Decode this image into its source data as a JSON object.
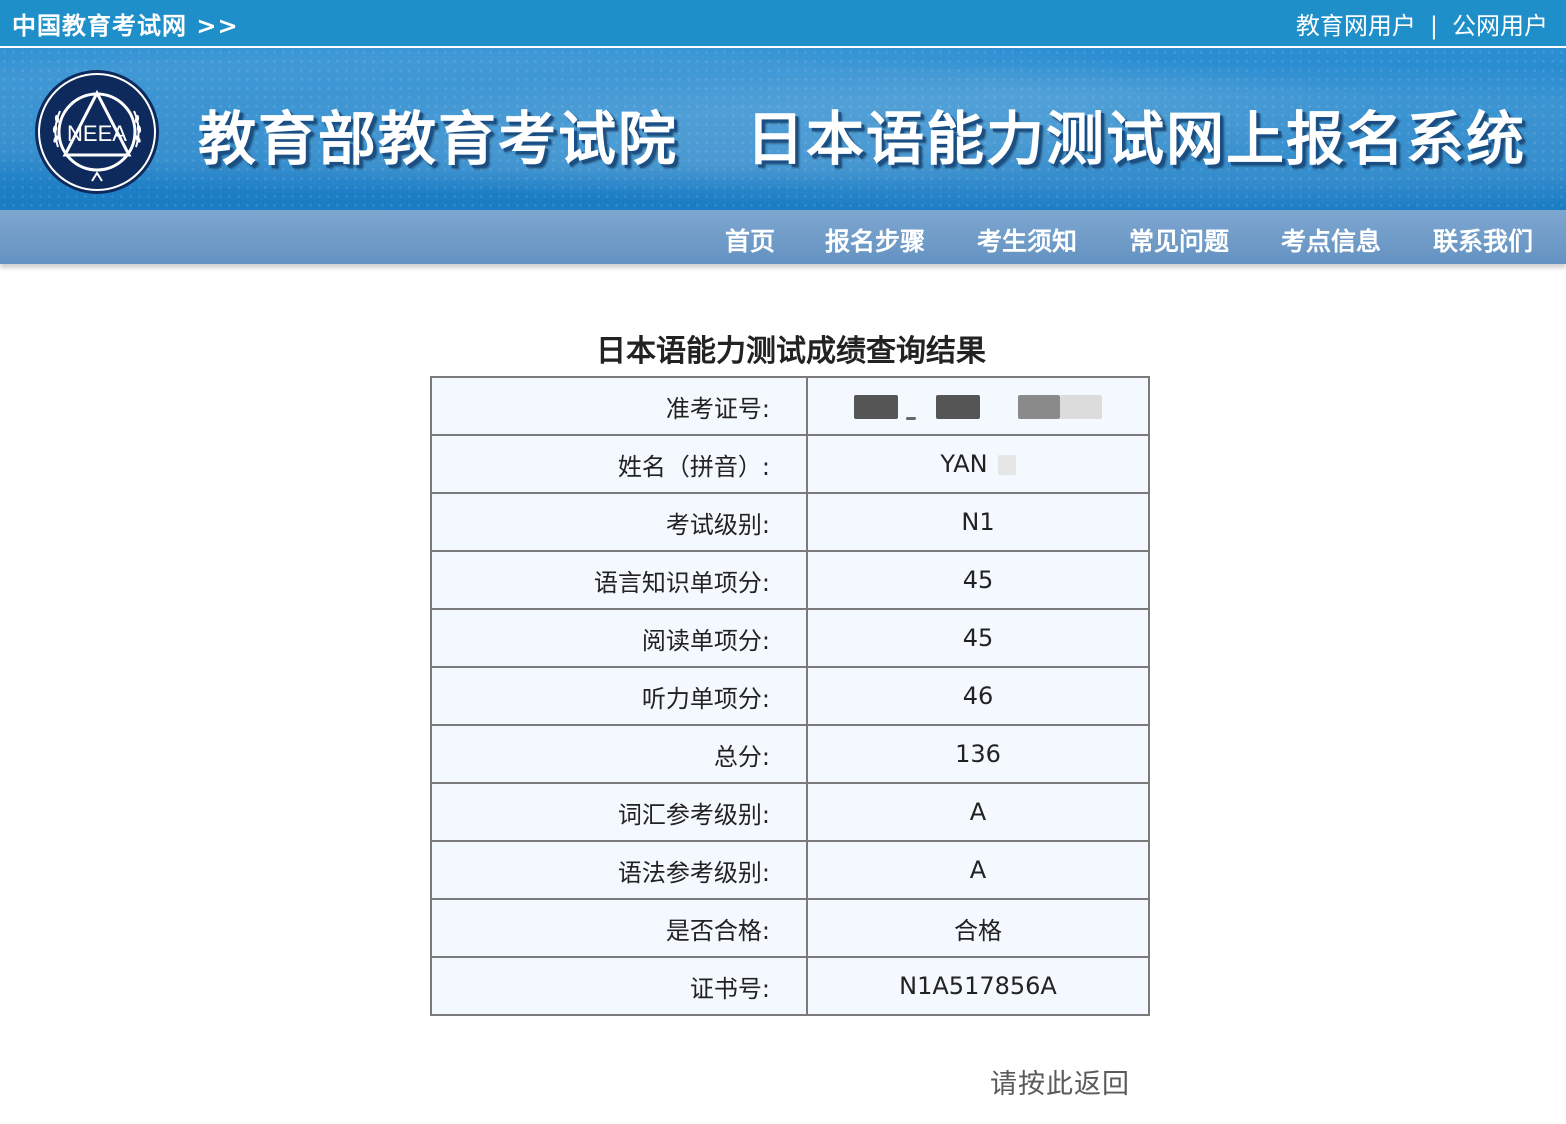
{
  "topbar": {
    "site_link": "中国教育考试网 >>",
    "user_links": [
      "教育网用户",
      "公网用户"
    ],
    "separator": "|"
  },
  "banner": {
    "logo_text": "NEEA",
    "title_left": "教育部教育考试院",
    "title_right": "日本语能力测试网上报名系统"
  },
  "nav": {
    "items": [
      "首页",
      "报名步骤",
      "考生须知",
      "常见问题",
      "考点信息",
      "联系我们"
    ]
  },
  "result": {
    "title": "日本语能力测试成绩查询结果",
    "rows": [
      {
        "label": "准考证号:",
        "value": ""
      },
      {
        "label": "姓名（拼音）:",
        "value": "YAN"
      },
      {
        "label": "考试级别:",
        "value": "N1"
      },
      {
        "label": "语言知识单项分:",
        "value": "45"
      },
      {
        "label": "阅读单项分:",
        "value": "45"
      },
      {
        "label": "听力单项分:",
        "value": "46"
      },
      {
        "label": "总分:",
        "value": "136"
      },
      {
        "label": "词汇参考级别:",
        "value": "A"
      },
      {
        "label": "语法参考级别:",
        "value": "A"
      },
      {
        "label": "是否合格:",
        "value": "合格"
      },
      {
        "label": "证书号:",
        "value": "N1A517856A"
      }
    ]
  },
  "back_link": "请按此返回",
  "colors": {
    "topbar": "#1f8fc9",
    "banner": "#2285cc",
    "navbar": "#6f9cc9",
    "table_cell": "#f4f8ff",
    "table_border": "#7a7a7a"
  }
}
